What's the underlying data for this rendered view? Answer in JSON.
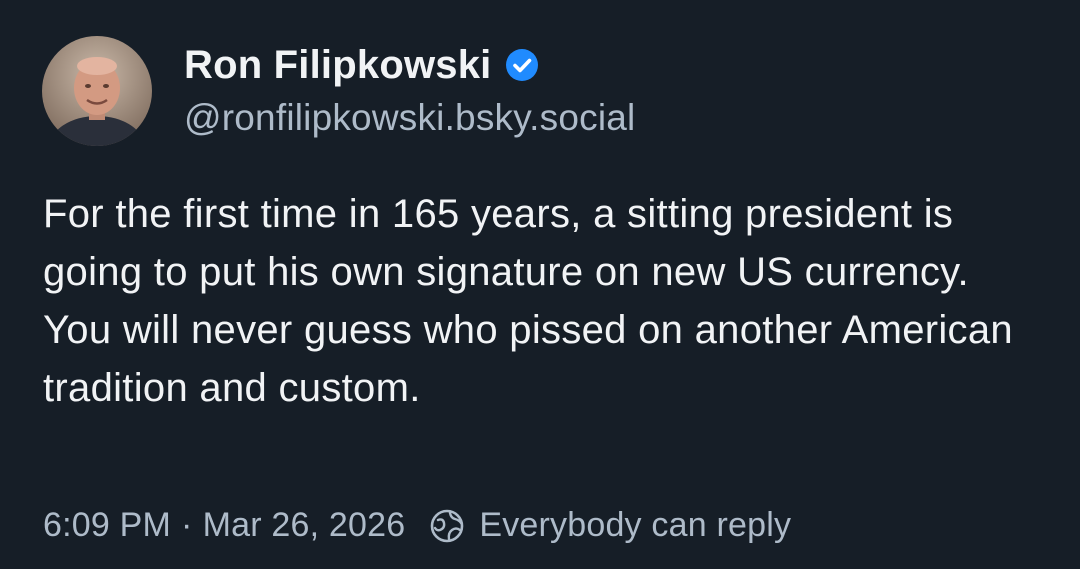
{
  "post": {
    "author": {
      "display_name": "Ron Filipkowski",
      "handle": "@ronfilipkowski.bsky.social",
      "avatar_icon": "profile-photo",
      "verified_icon": "verified-badge-icon"
    },
    "text": "For the first time in 165 years, a sitting president is going to put his own signature on new US currency. You will never guess who pissed on another American tradition and custom.",
    "meta": {
      "time": "6:09 PM",
      "separator": "·",
      "date": "Mar 26, 2026",
      "reply_icon": "globe-icon",
      "reply_setting": "Everybody can reply"
    }
  },
  "colors": {
    "background": "#161e27",
    "text": "#f1f3f5",
    "muted": "#aebbc9",
    "verified": "#208bfe"
  }
}
